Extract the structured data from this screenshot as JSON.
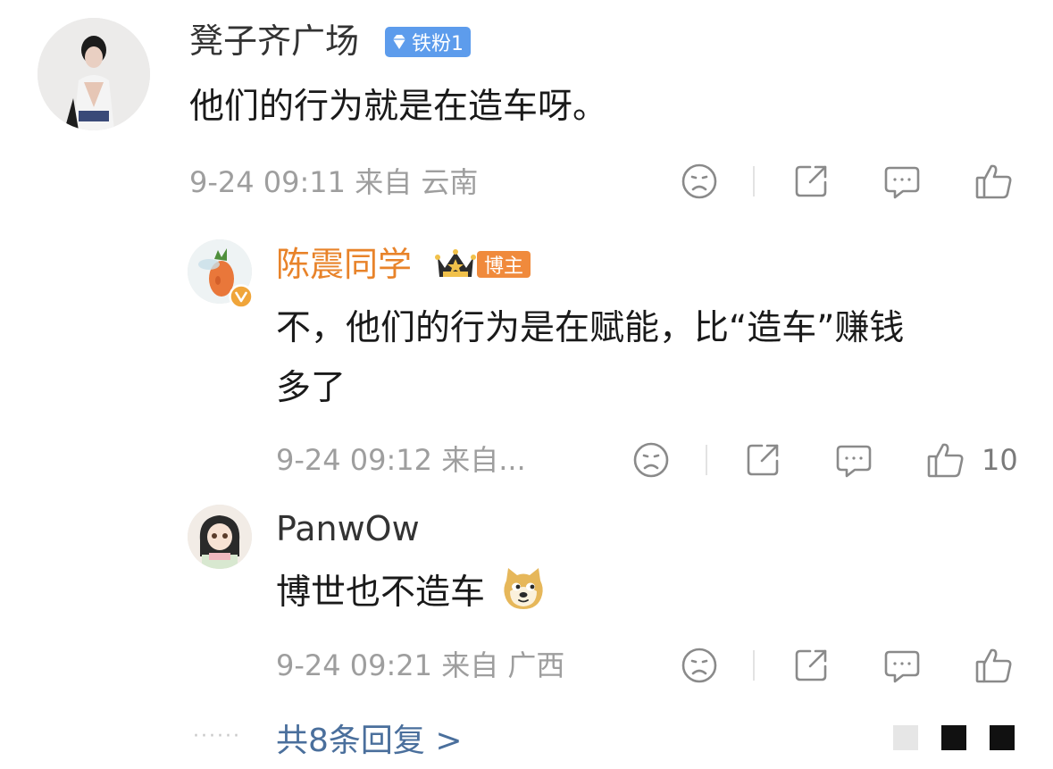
{
  "comments": [
    {
      "username": "凳子齐广场",
      "badge": "铁粉1",
      "text": "他们的行为就是在造车呀。",
      "meta": "9-24 09:11 来自 云南",
      "like_count": ""
    },
    {
      "username": "陈震同学",
      "badge": "博主",
      "text_line1": "不，他们的行为是在赋能，比“造车”赚钱",
      "text_line2": "多了",
      "meta": "9-24 09:12 来自...",
      "like_count": "10"
    },
    {
      "username": "PanwOw",
      "text": "博世也不造车",
      "meta": "9-24 09:21 来自 广西",
      "like_count": ""
    }
  ],
  "reply_link": "共8条回复 >",
  "leading_dots": "······",
  "icons": [
    "sad-face-icon",
    "share-icon",
    "comment-icon",
    "like-icon",
    "verified-v-icon",
    "crown-icon",
    "diamond-icon",
    "doge-emoji-icon"
  ],
  "colors": {
    "username": "#333333",
    "blogger_name": "#e8832a",
    "meta": "#9e9e9e",
    "link": "#4a6f9c",
    "fan_badge": "#5d9cec",
    "blogger_tag": "#f08a3c"
  }
}
